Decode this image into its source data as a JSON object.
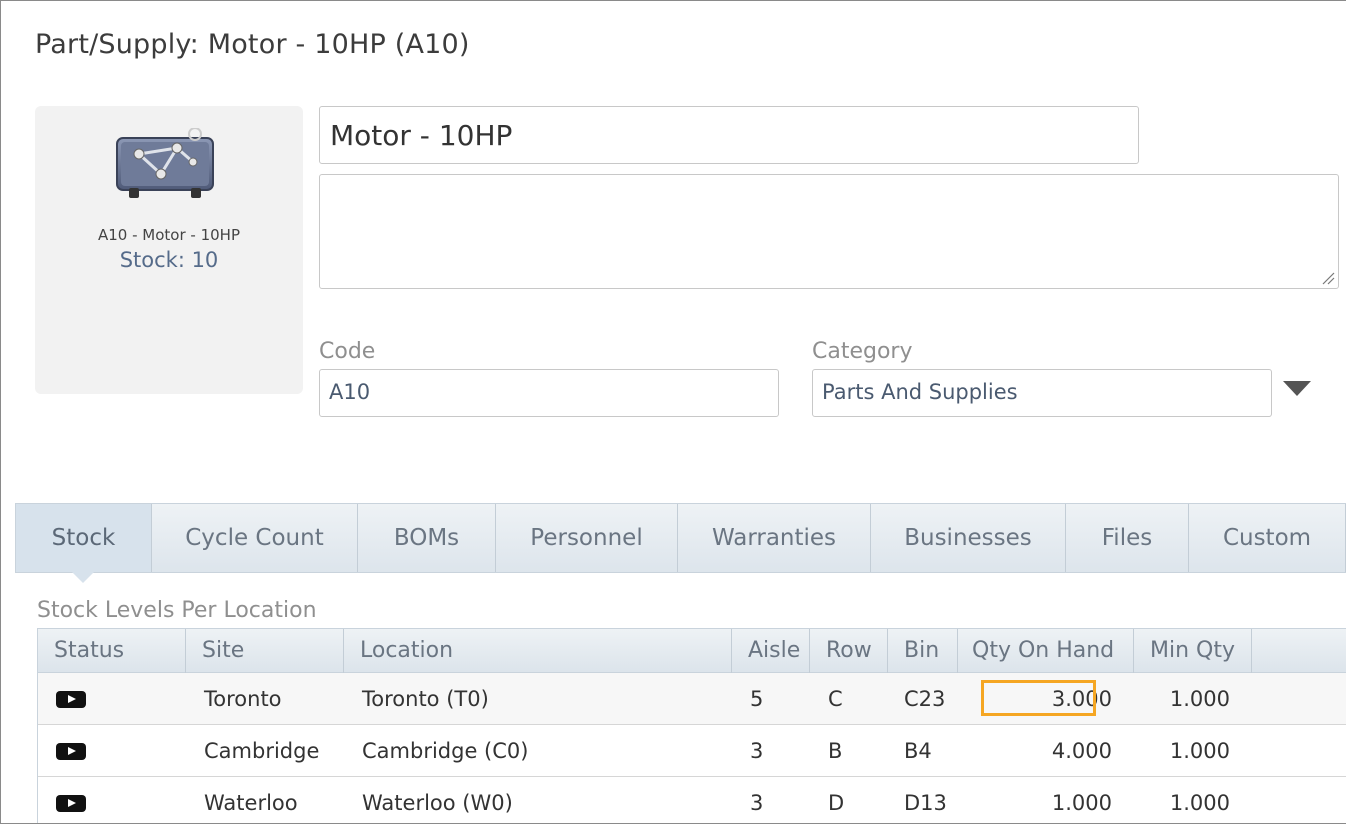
{
  "page_title": "Part/Supply: Motor - 10HP (A10)",
  "card": {
    "caption": "A10 - Motor - 10HP",
    "stock_text": "Stock: 10",
    "icon": "motor-image-icon"
  },
  "form": {
    "name_value": "Motor - 10HP",
    "description_value": "",
    "code_label": "Code",
    "code_value": "A10",
    "category_label": "Category",
    "category_value": "Parts And Supplies"
  },
  "tabs": [
    {
      "label": "Stock",
      "active": true
    },
    {
      "label": "Cycle Count"
    },
    {
      "label": "BOMs"
    },
    {
      "label": "Personnel"
    },
    {
      "label": "Warranties"
    },
    {
      "label": "Businesses"
    },
    {
      "label": "Files"
    },
    {
      "label": "Custom"
    }
  ],
  "stock_section": {
    "title": "Stock Levels Per Location",
    "columns": [
      "Status",
      "Site",
      "Location",
      "Aisle",
      "Row",
      "Bin",
      "Qty On Hand",
      "Min Qty"
    ],
    "rows": [
      {
        "site": "Toronto",
        "location": "Toronto (T0)",
        "aisle": "5",
        "row": "C",
        "bin": "C23",
        "qty_on_hand": "3.000",
        "min_qty": "1.000"
      },
      {
        "site": "Cambridge",
        "location": "Cambridge (C0)",
        "aisle": "3",
        "row": "B",
        "bin": "B4",
        "qty_on_hand": "4.000",
        "min_qty": "1.000"
      },
      {
        "site": "Waterloo",
        "location": "Waterloo (W0)",
        "aisle": "3",
        "row": "D",
        "bin": "D13",
        "qty_on_hand": "1.000",
        "min_qty": "1.000"
      }
    ]
  },
  "colors": {
    "highlight": "#f5a623",
    "accent_text": "#556b8a"
  }
}
